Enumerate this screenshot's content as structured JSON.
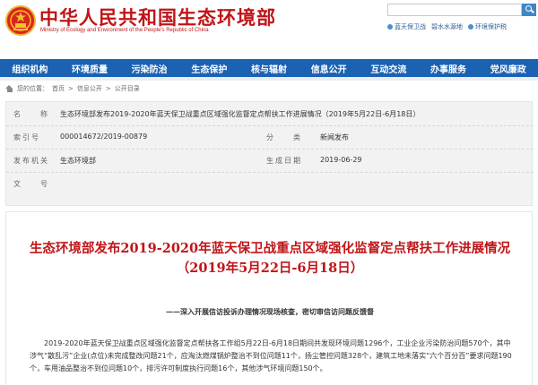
{
  "header": {
    "site_title": "中华人民共和国生态环境部",
    "site_subtitle": "Ministry of Ecology and Environment of the People's Republic of China",
    "quicklinks": [
      "蓝天保卫战",
      "碧水水源地",
      "环境保护税"
    ],
    "search_placeholder": ""
  },
  "nav": {
    "items": [
      "组织机构",
      "环境质量",
      "污染防治",
      "生态保护",
      "核与辐射",
      "信息公开",
      "互动交流",
      "办事服务",
      "党风廉政"
    ]
  },
  "breadcrumb": {
    "prefix": "您的位置：",
    "items": [
      "首页",
      "信息公开",
      "公开目录"
    ],
    "sep": ">"
  },
  "info": {
    "title_label": "名　　称",
    "title_value": "生态环境部发布2019-2020年蓝天保卫战重点区域强化监督定点帮扶工作进展情况（2019年5月22日-6月18日）",
    "index_label": "索引号",
    "index_value": "000014672/2019-00879",
    "category_label": "分　　类",
    "category_value": "新闻发布",
    "org_label": "发布机关",
    "org_value": "生态环境部",
    "date_label": "生成日期",
    "date_value": "2019-06-29",
    "docno_label": "文　　号",
    "docno_value": ""
  },
  "article": {
    "title_line1": "生态环境部发布2019-2020年蓝天保卫战重点区域强化监督定点帮扶工作进展情况",
    "title_line2": "（2019年5月22日-6月18日）",
    "subtitle": "——深入开展信访投诉办理情况现场核查，密切审信访问题反馈督",
    "body": "2019-2020年蓝天保卫战重点区域强化监督定点帮扶各工作组5月22日-6月18日期间共发现环境问题1296个，工业企业污染防治问题570个，其中涉气“散乱污”企业(点位)未完成整改问题21个，应淘汰燃煤锅炉整治不到位问题11个，扬尘管控问题328个，建筑工地未落实“六个百分百”要求问题190个，车用油品整治不到位问题10个，排污许可制度执行问题16个，其他涉气环境问题150个。"
  },
  "colors": {
    "brand_red": "#c01518",
    "nav_blue": "#1b62b3"
  }
}
